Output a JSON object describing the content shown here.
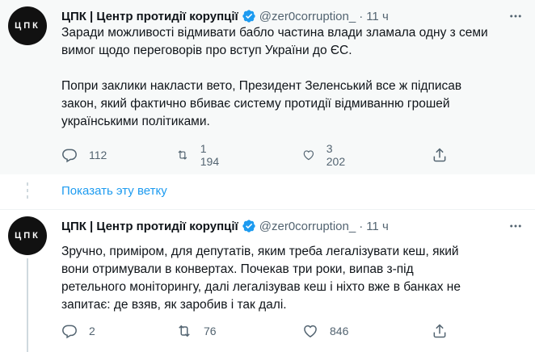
{
  "tweets": [
    {
      "avatar_text": "ЦПК",
      "name": "ЦПК | Центр протидії корупції",
      "handle": "@zer0corruption_",
      "time": "11 ч",
      "text": "Заради можливості відмивати бабло частина влади зламала одну з семи\nвимог щодо переговорів про вступ України до ЄС.\n\nПопри заклики накласти вето, Президент Зеленський все ж підписав\nзакон, який фактично вбиває систему протидії відмиванню грошей\nукраїнськими політиками.",
      "replies": "112",
      "retweets": "1 194",
      "likes": "3 202"
    },
    {
      "avatar_text": "ЦПК",
      "name": "ЦПК | Центр протидії корупції",
      "handle": "@zer0corruption_",
      "time": "11 ч",
      "text": "Зручно, приміром, для депутатів, яким треба легалізувати кеш, який\nвони отримували в конвертах. Почекав три роки, випав з-під\nретельного моніторингу, далі легалізував кеш і ніхто вже в банках не\nзапитає: де взяв, як заробив і так далі.",
      "replies": "2",
      "retweets": "76",
      "likes": "846"
    }
  ],
  "show_thread_label": "Показать эту ветку",
  "dot": "·",
  "colors": {
    "accent": "#1d9bf0",
    "muted": "#536471",
    "text": "#0f1419"
  },
  "icons": [
    "verified-badge-icon",
    "more-icon",
    "reply-icon",
    "retweet-icon",
    "like-icon",
    "share-icon"
  ]
}
